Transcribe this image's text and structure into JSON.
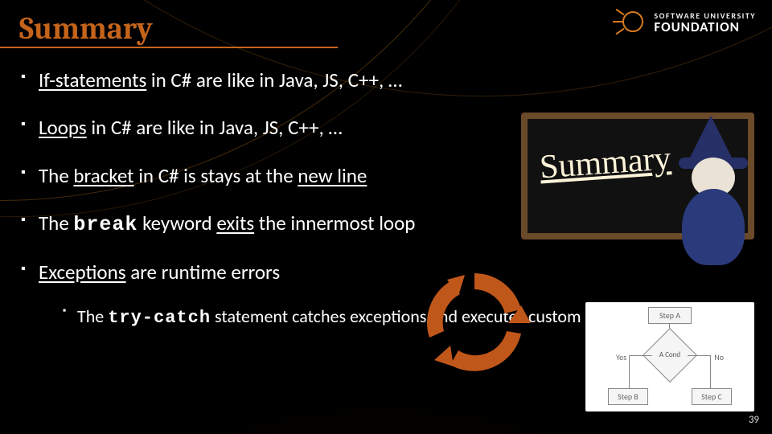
{
  "title": "Summary",
  "logo": {
    "line1": "SOFTWARE UNIVERSITY",
    "line2": "FOUNDATION"
  },
  "bullets": [
    {
      "pre": "",
      "u1": "If-statements",
      "mid": " in C# are like in Java, JS, C++, …"
    },
    {
      "pre": "",
      "u1": "Loops",
      "mid": " in C# are like in Java, JS, C++, …"
    },
    {
      "pre": "The ",
      "u1": "bracket",
      "mid": " in C# is stays at the ",
      "u2": "new line"
    },
    {
      "pre": "The ",
      "code": "break",
      "mid": " keyword ",
      "u1": "exits",
      "tail": " the innermost loop"
    },
    {
      "pre": "",
      "u1": "Exceptions",
      "mid": " are runtime errors"
    }
  ],
  "sub": {
    "pre": "The ",
    "code": "try-catch",
    "mid": " statement catches exceptions and executes custom logic"
  },
  "chalkboard_text": "Summary",
  "flowchart": {
    "stepA": "Step A",
    "stepB": "Step B",
    "stepC": "Step C",
    "cond": "A Cond",
    "yes": "Yes",
    "no": "No"
  },
  "page_number": "39"
}
